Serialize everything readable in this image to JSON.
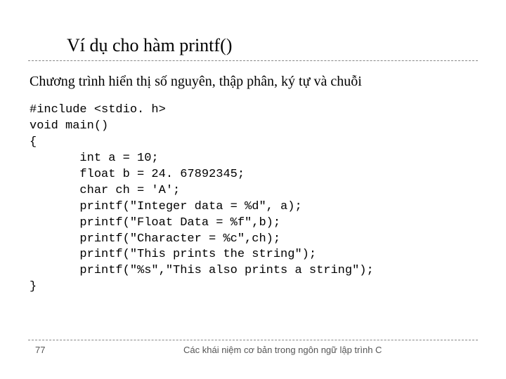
{
  "title": "Ví dụ cho hàm printf()",
  "subtitle": "Chương trình hiển thị số nguyên, thập phân, ký tự và chuỗi",
  "code": {
    "l1": "#include <stdio. h>",
    "l2": "void main()",
    "l3": "{",
    "l4": "       int a = 10;",
    "l5": "       float b = 24. 67892345;",
    "l6": "       char ch = 'A';",
    "l7": "       printf(\"Integer data = %d\", a);",
    "l8": "       printf(\"Float Data = %f\",b);",
    "l9": "       printf(\"Character = %c\",ch);",
    "l10": "       printf(\"This prints the string\");",
    "l11": "       printf(\"%s\",\"This also prints a string\");",
    "l12": "}"
  },
  "footer": {
    "page": "77",
    "text": "Các khái niệm cơ bản trong ngôn ngữ lập trình C"
  }
}
